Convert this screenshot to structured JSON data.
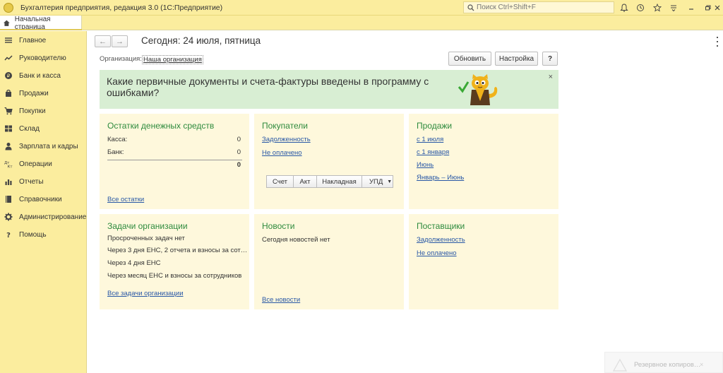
{
  "titlebar": {
    "title": "Бухгалтерия предприятия, редакция 3.0  (1С:Предприятие)",
    "search_placeholder": "Поиск Ctrl+Shift+F"
  },
  "tabs": {
    "home_label": "Начальная страница"
  },
  "sidebar": {
    "items": [
      {
        "label": "Главное",
        "icon": "menu-icon"
      },
      {
        "label": "Руководителю",
        "icon": "trend-icon"
      },
      {
        "label": "Банк и касса",
        "icon": "coin-icon"
      },
      {
        "label": "Продажи",
        "icon": "bag-icon"
      },
      {
        "label": "Покупки",
        "icon": "cart-icon"
      },
      {
        "label": "Склад",
        "icon": "warehouse-icon"
      },
      {
        "label": "Зарплата и кадры",
        "icon": "person-icon"
      },
      {
        "label": "Операции",
        "icon": "operations-icon"
      },
      {
        "label": "Отчеты",
        "icon": "chart-icon"
      },
      {
        "label": "Справочники",
        "icon": "book-icon"
      },
      {
        "label": "Администрирование",
        "icon": "gear-icon"
      },
      {
        "label": "Помощь",
        "icon": "help-icon"
      }
    ]
  },
  "header": {
    "title": "Сегодня: 24 июля, пятница",
    "org_label": "Организация:",
    "org_value": "Наша организация",
    "refresh_label": "Обновить",
    "settings_label": "Настройка",
    "help_label": "?"
  },
  "banner": {
    "text": "Какие первичные документы и счета-фактуры введены в программу с ошибками?",
    "close": "×"
  },
  "cash": {
    "title": "Остатки денежных средств",
    "kassa_label": "Касса:",
    "kassa_value": "0",
    "bank_label": "Банк:",
    "bank_value": "0",
    "total": "0",
    "link": "Все остатки"
  },
  "buyers": {
    "title": "Покупатели",
    "link1": "Задолженность",
    "link2": "Не оплачено",
    "buttons": [
      "Счет",
      "Акт",
      "Накладная",
      "УПД"
    ]
  },
  "sales": {
    "title": "Продажи",
    "links": [
      "с 1 июля",
      "с 1 января",
      "Июнь",
      "Январь – Июнь"
    ]
  },
  "tasks": {
    "title": "Задачи организации",
    "items": [
      "Просроченных задач нет",
      "Через 3 дня ЕНС, 2 отчета и взносы за сот…",
      "Через 4 дня ЕНС",
      "Через месяц ЕНС и взносы за сотрудников"
    ],
    "link": "Все задачи организации"
  },
  "news": {
    "title": "Новости",
    "text": "Сегодня новостей нет",
    "link": "Все новости"
  },
  "suppliers": {
    "title": "Поставщики",
    "link1": "Задолженность",
    "link2": "Не оплачено"
  },
  "toast": {
    "text": "Резервное копиров…",
    "close": "×"
  },
  "colors": {
    "accent_yellow": "#fbed9e",
    "panel": "#fef8dc",
    "banner": "#d8eed3",
    "title_green": "#2e8b3e",
    "link_blue": "#2958a6"
  }
}
